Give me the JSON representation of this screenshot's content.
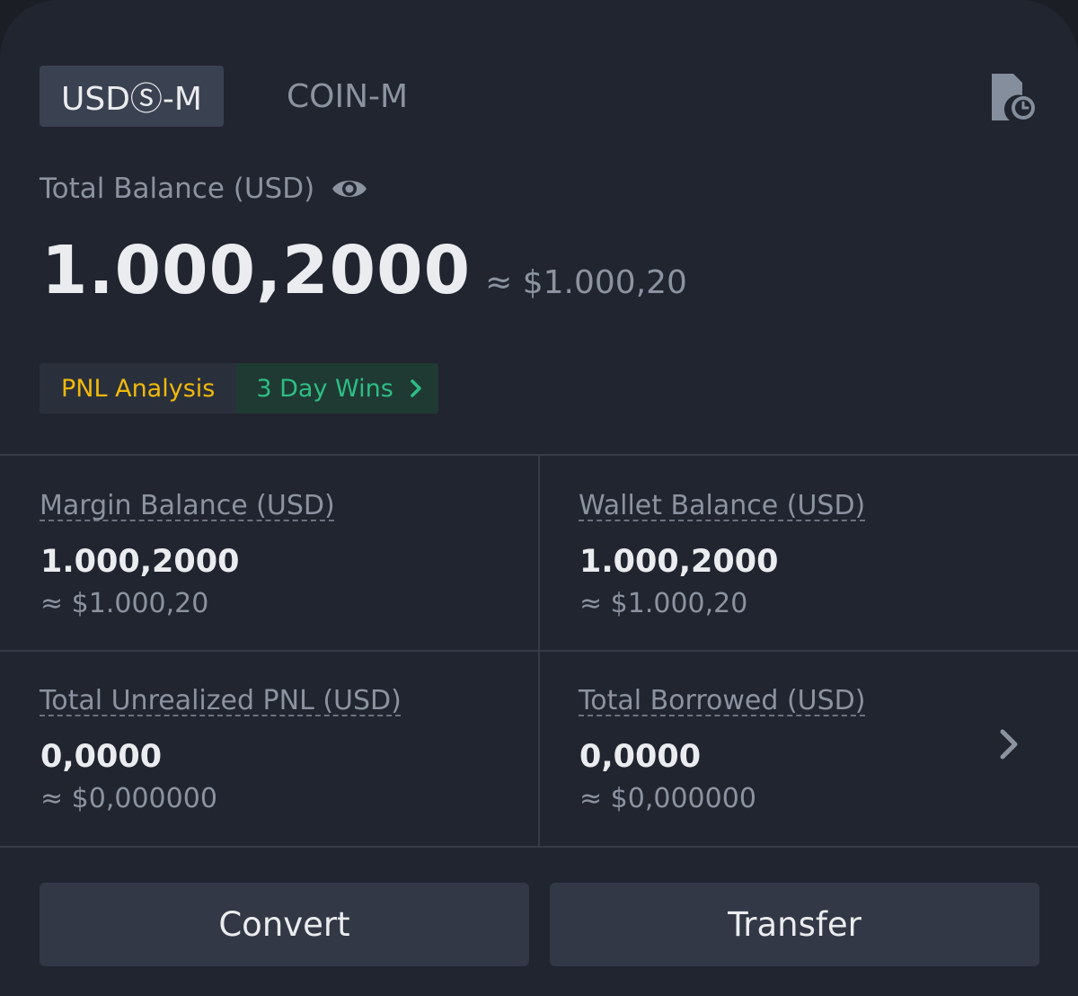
{
  "tabs": [
    {
      "label": "USDⓈ-M",
      "active": true
    },
    {
      "label": "COIN-M",
      "active": false
    }
  ],
  "header": {
    "history_icon": "transaction-history-icon"
  },
  "balance": {
    "label": "Total Balance (USD)",
    "eye_icon": "eye-icon",
    "value": "1.000,2000",
    "approx": "≈ $1.000,20"
  },
  "pnl": {
    "analysis_label": "PNL Analysis",
    "wins_label": "3 Day Wins",
    "wins_chevron_icon": "chevron-right-icon"
  },
  "stats": [
    {
      "label": "Margin Balance (USD)",
      "value": "1.000,2000",
      "approx": "≈ $1.000,20"
    },
    {
      "label": "Wallet Balance (USD)",
      "value": "1.000,2000",
      "approx": "≈ $1.000,20"
    },
    {
      "label": "Total Unrealized PNL (USD)",
      "value": "0,0000",
      "approx": "≈ $0,000000"
    },
    {
      "label": "Total Borrowed (USD)",
      "value": "0,0000",
      "approx": "≈ $0,000000"
    }
  ],
  "actions": {
    "convert_label": "Convert",
    "transfer_label": "Transfer"
  },
  "colors": {
    "background": "#212530",
    "accent_yellow": "#f0b90b",
    "accent_green": "#2ebd85",
    "text_primary": "#eaecef",
    "text_secondary": "#8b93a0"
  }
}
